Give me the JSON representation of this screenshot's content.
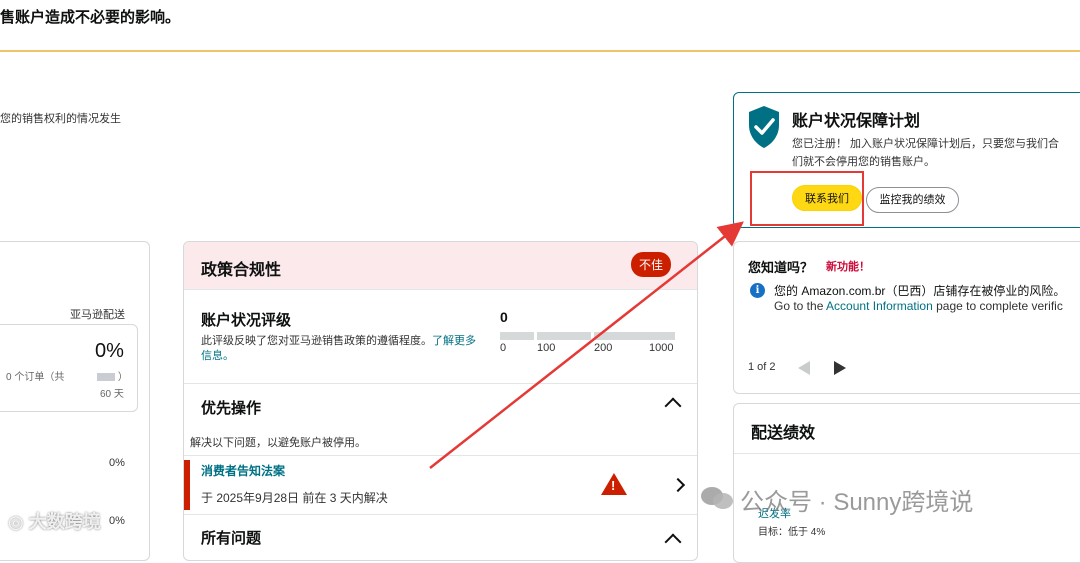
{
  "top_banner": {
    "text": "售账户造成不必要的影响。"
  },
  "left_note": {
    "text": "您的销售权利的情况发生"
  },
  "left_card": {
    "label": "亚马逊配送",
    "percent": "0%",
    "orders": "0 个订单（共",
    "orders_close": "）",
    "days": "60 天",
    "value_2": "0%",
    "value_3": "0%"
  },
  "policy": {
    "title": "政策合规性",
    "status_badge": "不佳",
    "ahr_title": "账户状况评级",
    "ahr_desc": "此评级反映了您对亚马逊销售政策的遵循程度。",
    "ahr_link": "了解更多信息。",
    "ahr_score": "0",
    "scale_ticks": [
      "0",
      "100",
      "200",
      "1000"
    ],
    "priority_title": "优先操作",
    "priority_desc": "解决以下问题，以避免账户被停用。",
    "issue_name": "消费者告知法案",
    "issue_due": "于 2025年9月28日 前在 3 天内解决",
    "all_issues_title": "所有问题"
  },
  "ahp": {
    "title": "账户状况保障计划",
    "desc_line1": "您已注册！ 加入账户状况保障计划后，只要您与我们合",
    "desc_line2": "们就不会停用您的销售账户。",
    "contact_button": "联系我们",
    "monitor_button": "监控我的绩效"
  },
  "did_you_know": {
    "title": "您知道吗？",
    "new_feature": "新功能！",
    "line1": "您的 Amazon.com.br（巴西）店铺存在被停业的风险。",
    "line2_prefix": "Go to the ",
    "line2_link": "Account Information",
    "line2_suffix": " page to complete verific",
    "pager": "1 of 2"
  },
  "shipping": {
    "title": "配送绩效",
    "late_rate": "迟发率",
    "target": "目标：低于 4%"
  },
  "watermarks": {
    "left": "大数跨境",
    "right": "公众号 · Sunny跨境说"
  },
  "colors": {
    "accent_teal": "#007185",
    "badge_red": "#cc1f00",
    "button_yellow": "#ffd814",
    "annotation_red": "#e53935",
    "policy_header_bg": "#fbe9ec"
  }
}
